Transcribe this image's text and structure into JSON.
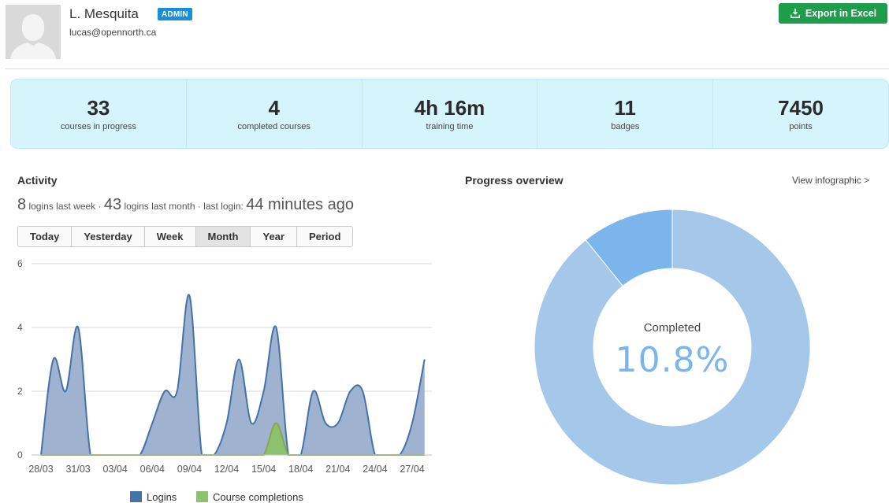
{
  "user": {
    "name": "L. Mesquita",
    "role_badge": "ADMIN",
    "email": "lucas@opennorth.ca"
  },
  "actions": {
    "export_label": "Export in Excel"
  },
  "stats": [
    {
      "value": "33",
      "label": "courses in progress"
    },
    {
      "value": "4",
      "label": "completed courses"
    },
    {
      "value": "4h 16m",
      "label": "training time"
    },
    {
      "value": "11",
      "label": "badges"
    },
    {
      "value": "7450",
      "label": "points"
    }
  ],
  "activity": {
    "title": "Activity",
    "logins_week": "8",
    "logins_week_label": "logins last week ·",
    "logins_month": "43",
    "logins_month_label": "logins last month · last login:",
    "last_login": "44 minutes ago",
    "tabs": [
      "Today",
      "Yesterday",
      "Week",
      "Month",
      "Year",
      "Period"
    ],
    "active_tab": "Month"
  },
  "progress": {
    "title": "Progress overview",
    "infographic_link": "View infographic >",
    "completed_label": "Completed",
    "completed_value": "10.8%",
    "completed_fraction": 0.108
  },
  "colors": {
    "logins": "#4572a7",
    "logins_fill": "#9fb2cf",
    "completions": "#89a54e",
    "completions_fill": "#8bc26a",
    "donut_main": "#a5c8ea",
    "donut_completed": "#7cb5ec",
    "export_btn": "#1e9e4a",
    "stats_bg": "#d6f4fc"
  },
  "chart_data": {
    "type": "area",
    "x": [
      "28/03",
      "29/03",
      "30/03",
      "31/03",
      "01/04",
      "02/04",
      "03/04",
      "04/04",
      "05/04",
      "06/04",
      "07/04",
      "08/04",
      "09/04",
      "10/04",
      "11/04",
      "12/04",
      "13/04",
      "14/04",
      "15/04",
      "16/04",
      "17/04",
      "18/04",
      "19/04",
      "20/04",
      "21/04",
      "22/04",
      "23/04",
      "24/04",
      "25/04",
      "26/04",
      "27/04",
      "28/04"
    ],
    "tick_labels": [
      "28/03",
      "31/03",
      "03/04",
      "06/04",
      "09/04",
      "12/04",
      "15/04",
      "18/04",
      "21/04",
      "24/04",
      "27/04"
    ],
    "series": [
      {
        "name": "Logins",
        "values": [
          0,
          3,
          2,
          4,
          0,
          0,
          0,
          0,
          0,
          1,
          2,
          2,
          5,
          0,
          0,
          1,
          3,
          1,
          2,
          4,
          0,
          0,
          2,
          1,
          1,
          2,
          2,
          0,
          0,
          0,
          1,
          3
        ]
      },
      {
        "name": "Course completions",
        "values": [
          0,
          0,
          0,
          0,
          0,
          0,
          0,
          0,
          0,
          0,
          0,
          0,
          0,
          0,
          0,
          0,
          0,
          0,
          0,
          1,
          0,
          0,
          0,
          0,
          0,
          0,
          0,
          0,
          0,
          0,
          0,
          0
        ]
      }
    ],
    "y_ticks": [
      0,
      2,
      4,
      6
    ],
    "ylim": [
      0,
      6
    ],
    "grid": true,
    "legend": "bottom"
  }
}
